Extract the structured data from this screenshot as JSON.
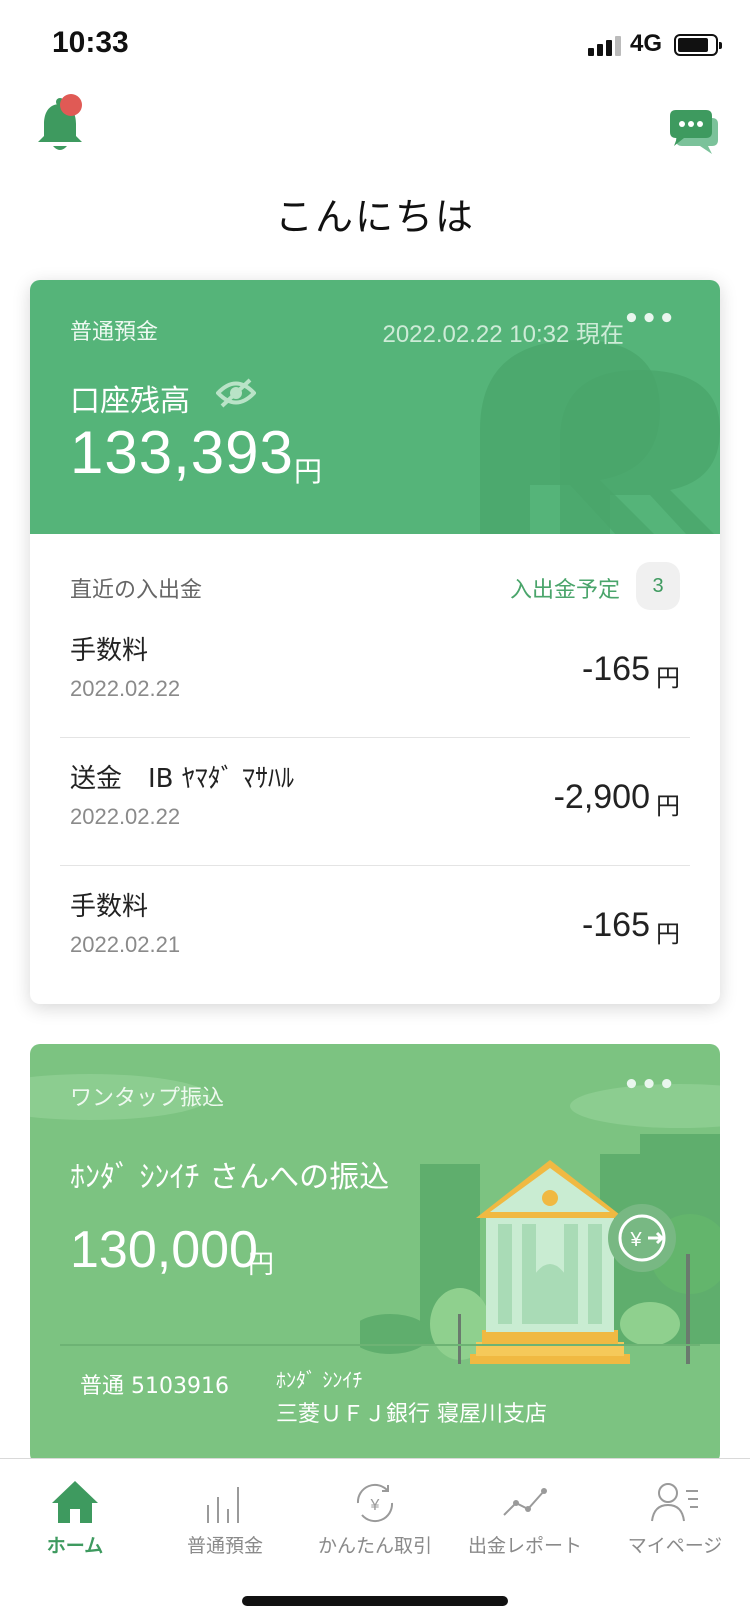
{
  "status_bar": {
    "time": "10:33",
    "network": "4G"
  },
  "header": {
    "greeting": "こんにちは"
  },
  "account": {
    "type": "普通預金",
    "as_of": "2022.02.22 10:32 現在",
    "more": "•••",
    "balance_label": "口座残高",
    "balance": "133,393",
    "currency": "円"
  },
  "recent": {
    "heading": "直近の入出金",
    "scheduled_label": "入出金予定",
    "scheduled_count": "3",
    "transactions": [
      {
        "name": "手数料",
        "date": "2022.02.22",
        "amount": "-165",
        "unit": "円"
      },
      {
        "name": "送金　IB ﾔﾏﾀﾞ ﾏｻﾊﾙ",
        "date": "2022.02.22",
        "amount": "-2,900",
        "unit": "円"
      },
      {
        "name": "手数料",
        "date": "2022.02.21",
        "amount": "-165",
        "unit": "円"
      }
    ]
  },
  "onetap": {
    "title": "ワンタップ振込",
    "more": "•••",
    "payee": "ﾎﾝﾀﾞ ｼﾝｲﾁ さんへの振込",
    "amount": "130,000",
    "unit": "円",
    "account": "普通  5103916",
    "account_name": "ﾎﾝﾀﾞ ｼﾝｲﾁ",
    "bank": "三菱ＵＦＪ銀行 寝屋川支店",
    "fab_icon": "yen-transfer-icon"
  },
  "nav": {
    "items": [
      {
        "label": "ホーム",
        "icon": "home-icon",
        "active": true
      },
      {
        "label": "普通預金",
        "icon": "bar-chart-icon",
        "active": false
      },
      {
        "label": "かんたん取引",
        "icon": "yen-cycle-icon",
        "active": false
      },
      {
        "label": "出金レポート",
        "icon": "line-chart-icon",
        "active": false
      },
      {
        "label": "マイページ",
        "icon": "person-list-icon",
        "active": false
      }
    ]
  },
  "colors": {
    "brand_green": "#55b479",
    "onetap_green": "#7cc381",
    "accent_text": "#3e9a5f",
    "notification_dot": "#e05a55"
  }
}
